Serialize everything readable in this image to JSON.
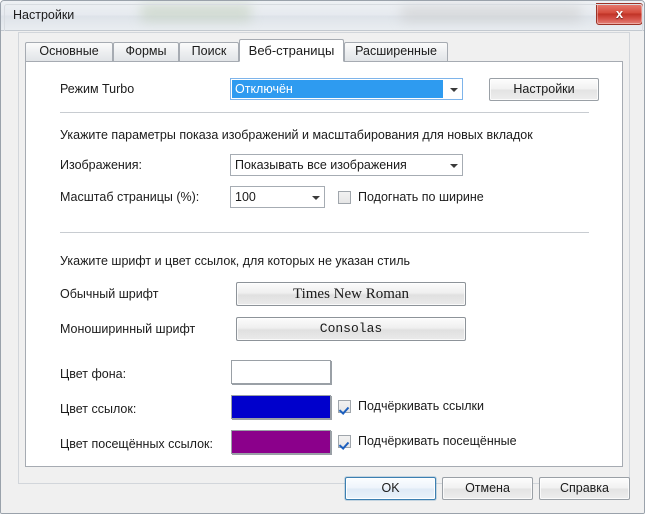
{
  "window": {
    "title": "Настройки",
    "close_glyph": "x"
  },
  "tabs": [
    {
      "label": "Основные",
      "active": false
    },
    {
      "label": "Формы",
      "active": false
    },
    {
      "label": "Поиск",
      "active": false
    },
    {
      "label": "Веб-страницы",
      "active": true
    },
    {
      "label": "Расширенные",
      "active": false
    }
  ],
  "turbo": {
    "label": "Режим Turbo",
    "value": "Отключён",
    "settings_button": "Настройки"
  },
  "images_section": {
    "note": "Укажите параметры показа изображений и масштабирования для новых вкладок",
    "images_label": "Изображения:",
    "images_value": "Показывать все изображения",
    "zoom_label": "Масштаб страницы (%):",
    "zoom_value": "100",
    "fit_width_label": "Подогнать по ширине",
    "fit_width_checked": false
  },
  "fonts_section": {
    "note": "Укажите шрифт и цвет ссылок, для которых не указан стиль",
    "normal_font_label": "Обычный шрифт",
    "normal_font_value": "Times New Roman",
    "mono_font_label": "Моноширинный шрифт",
    "mono_font_value": "Consolas"
  },
  "colors_section": {
    "background_label": "Цвет фона:",
    "background_color": "#ffffff",
    "link_label": "Цвет ссылок:",
    "link_color": "#0000cc",
    "visited_label": "Цвет посещённых ссылок:",
    "visited_color": "#8b008b",
    "underline_links_label": "Подчёркивать ссылки",
    "underline_links_checked": true,
    "underline_visited_label": "Подчёркивать посещённые",
    "underline_visited_checked": true
  },
  "footer": {
    "ok": "OK",
    "cancel": "Отмена",
    "help": "Справка"
  }
}
